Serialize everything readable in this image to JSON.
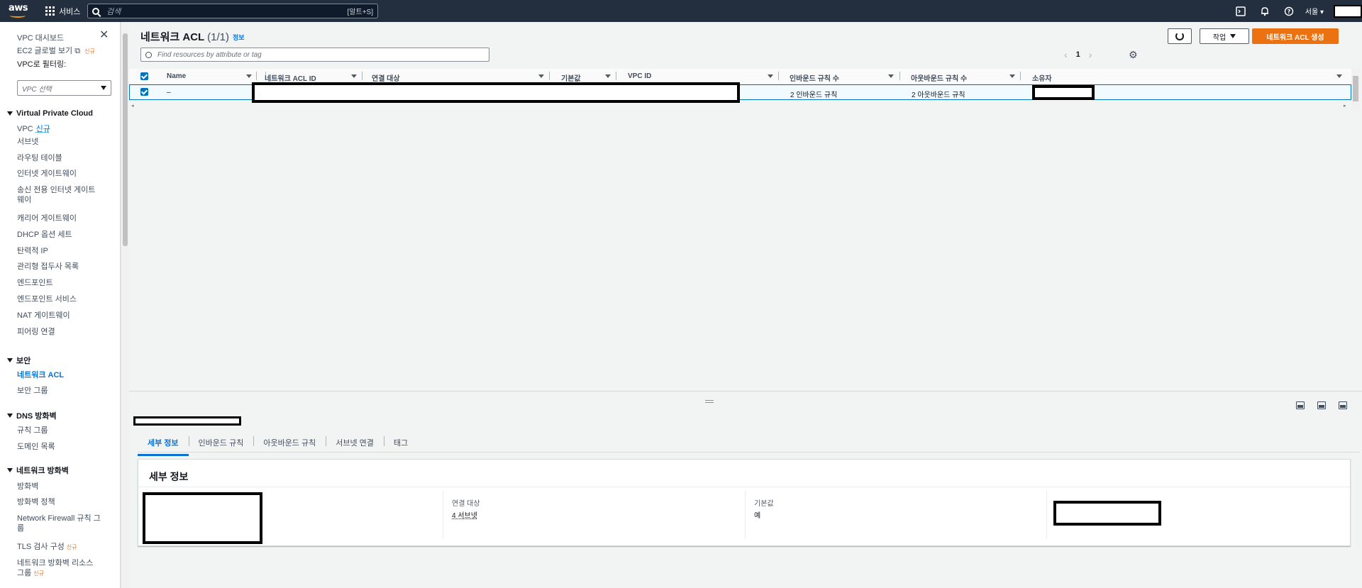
{
  "topnav": {
    "logo_text": "aws",
    "services_label": "서비스",
    "search_placeholder": "검색",
    "search_shortcut": "[알트+S]",
    "region": "서울"
  },
  "sidebar": {
    "dashboard": "VPC 대시보드",
    "ec2_global": "EC2 글로벌 보기",
    "new_badge": "신규",
    "filter_label": "VPC로 필터링:",
    "filter_placeholder": "VPC 선택",
    "sections": {
      "vpc": "Virtual Private Cloud",
      "security": "보안",
      "dns_firewall": "DNS 방화벽",
      "network_firewall": "네트워크 방화벽"
    },
    "vpc_items": [
      "VPC",
      "서브넷",
      "라우팅 테이블",
      "인터넷 게이트웨이",
      "송신 전용 인터넷 게이트",
      "웨이",
      "캐리어 게이트웨이",
      "DHCP 옵션 세트",
      "탄력적 IP",
      "관리형 접두사 목록",
      "엔드포인트",
      "엔드포인트 서비스",
      "NAT 게이트웨이",
      "피어링 연결"
    ],
    "security_items": [
      "네트워크 ACL",
      "보안 그룹"
    ],
    "dns_items": [
      "규칙 그룹",
      "도메인 목록"
    ],
    "nfw_items": [
      "방화벽",
      "방화벽 정책",
      "Network Firewall 규칙 그",
      "룹",
      "TLS 검사 구성",
      "네트워크 방화벽 리소스",
      "그룹"
    ]
  },
  "page": {
    "title": "네트워크 ACL",
    "count": "(1/1)",
    "info": "정보",
    "actions_label": "작업",
    "create_label": "네트워크 ACL 생성",
    "filter_placeholder": "Find resources by attribute or tag",
    "page_number": "1"
  },
  "table": {
    "columns": [
      "Name",
      "네트워크 ACL ID",
      "연결 대상",
      "기본값",
      "VPC ID",
      "인바운드 규칙 수",
      "아웃바운드 규칙 수",
      "소유자"
    ],
    "row": {
      "name": "–",
      "inbound": "2 인바운드 규칙",
      "outbound": "2 아웃바운드 규칙"
    }
  },
  "details": {
    "tabs": [
      "세부 정보",
      "인바운드 규칙",
      "아웃바운드 규칙",
      "서브넷 연결",
      "태그"
    ],
    "card_title": "세부 정보",
    "assoc_label": "연결 대상",
    "assoc_value": "4 서브넷",
    "default_label": "기본값",
    "default_value": "예"
  },
  "colors": {
    "nav_bg": "#232f3e",
    "accent_orange": "#ec7211",
    "link_blue": "#0972d3",
    "selected_row": "#f1faff"
  }
}
